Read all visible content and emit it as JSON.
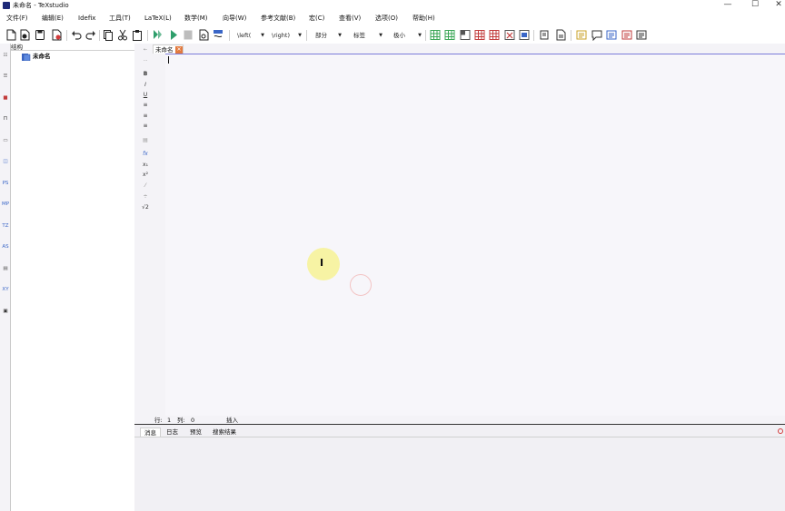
{
  "window": {
    "title": "未命名 - TeXstudio",
    "controls": {
      "minimize": "—",
      "maximize": "☐",
      "close": "✕"
    }
  },
  "menubar": {
    "items": [
      "文件(F)",
      "编辑(E)",
      "Idefix",
      "工具(T)",
      "LaTeX(L)",
      "数学(M)",
      "向导(W)",
      "参考文献(B)",
      "宏(C)",
      "查看(V)",
      "选项(O)",
      "帮助(H)"
    ]
  },
  "toolbar": {
    "combos": {
      "left_delim": "\\left(",
      "right_delim": "\\right)",
      "section": "部分",
      "label": "标签",
      "size": "极小"
    },
    "icons": [
      "new-file-icon",
      "new-from-template-icon",
      "save-icon",
      "close-file-icon",
      "undo-icon",
      "redo-icon",
      "copy-icon",
      "cut-icon",
      "paste-icon",
      "build-view-icon",
      "compile-icon",
      "stop-icon",
      "view-pdf-icon",
      "view-log-icon",
      "tabular-icon",
      "table-icon",
      "array-icon",
      "table-row-icon",
      "table-col-icon",
      "remove-row-icon",
      "remove-col-icon",
      "box-icon",
      "copy-format-icon",
      "comment-icon",
      "text-frame-icon",
      "text-frame-alt-icon",
      "text-frame-red-icon",
      "text-frame-plain-icon"
    ]
  },
  "leftbar": {
    "labels": [
      "PS",
      "MP",
      "TZ",
      "AS",
      "XY"
    ]
  },
  "structure": {
    "header": "结构",
    "root_item": "未命名"
  },
  "editor": {
    "tab_label": "未命名",
    "close_icon": "close-icon",
    "side_buttons": [
      "B",
      "I",
      "U",
      "fx",
      "x₁",
      "x²",
      "√2"
    ]
  },
  "statusbar": {
    "line_label": "行:",
    "line_value": "1",
    "col_label": "列:",
    "col_value": "0",
    "mode": "插入"
  },
  "bottom_panel": {
    "tabs": [
      "消息",
      "日志",
      "预览",
      "搜索结果"
    ]
  },
  "colors": {
    "accent_blue": "#3a66c7",
    "run_green": "#2e9e6b",
    "cursor_highlight": "#f7f3a4",
    "table_green": "#3aa655",
    "table_red": "#c23b3b"
  }
}
